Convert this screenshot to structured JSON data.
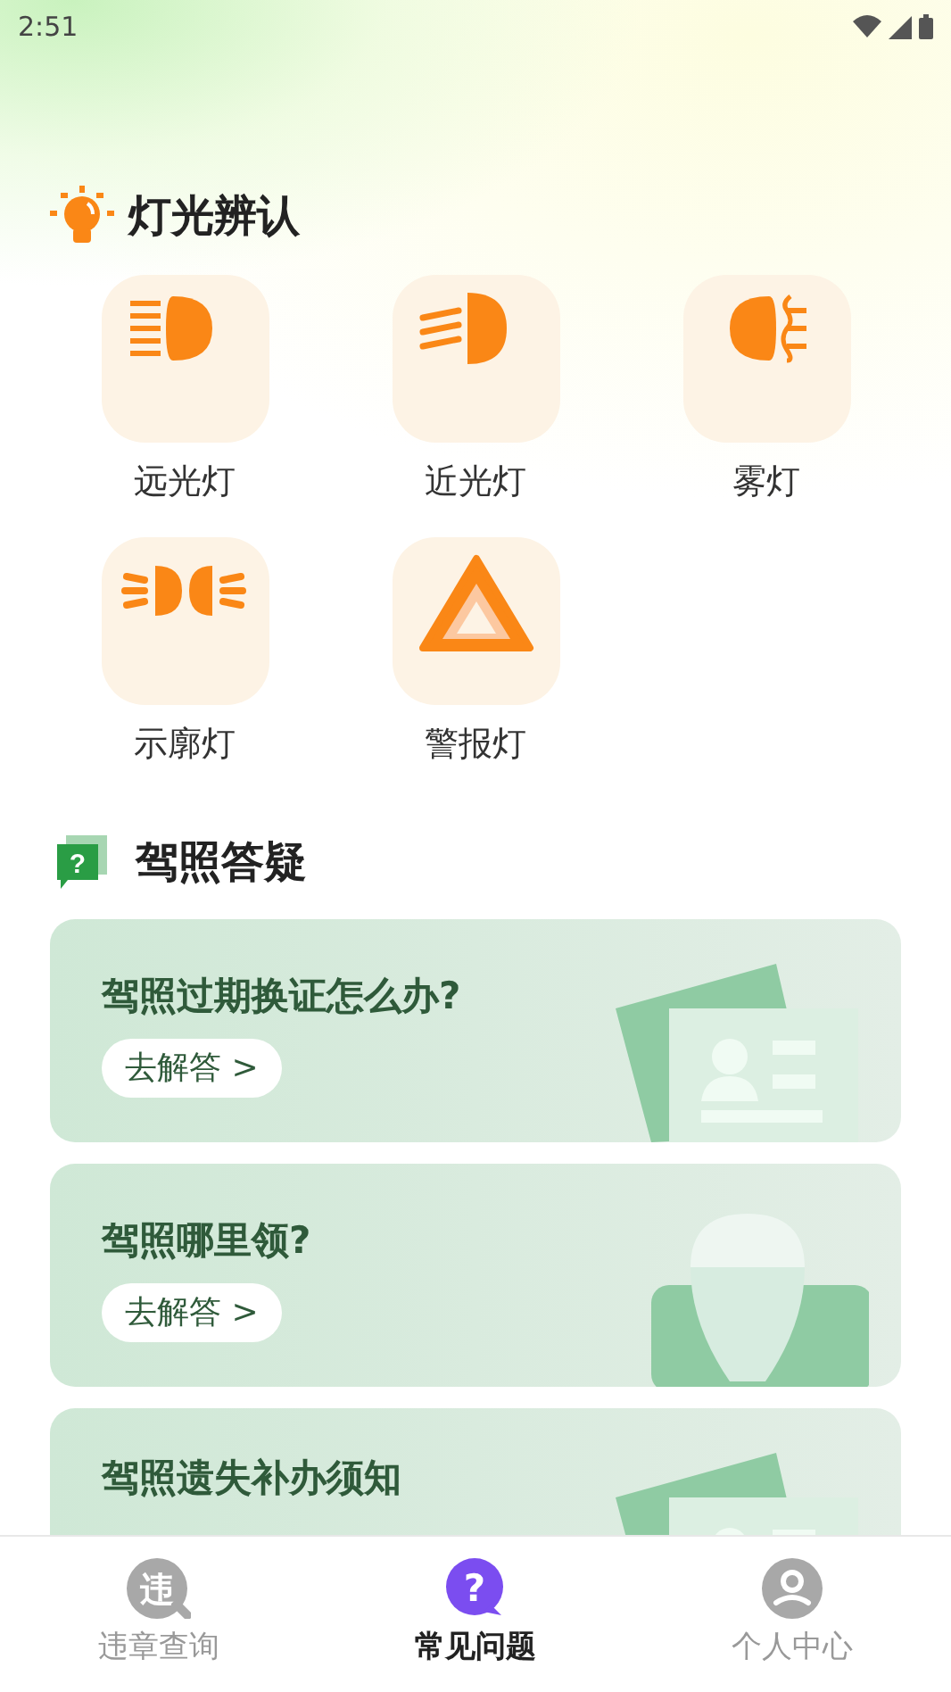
{
  "status_bar": {
    "time": "2:51"
  },
  "lights_section": {
    "title": "灯光辨认",
    "items": [
      {
        "label": "远光灯",
        "kind": "high-beam"
      },
      {
        "label": "近光灯",
        "kind": "low-beam"
      },
      {
        "label": "雾灯",
        "kind": "fog"
      },
      {
        "label": "示廓灯",
        "kind": "marker"
      },
      {
        "label": "警报灯",
        "kind": "hazard"
      }
    ]
  },
  "faq_section": {
    "title": "驾照答疑",
    "icon_text": "?",
    "cards": [
      {
        "title": "驾照过期换证怎么办?",
        "button": "去解答 >",
        "kind": "card"
      },
      {
        "title": "驾照哪里领?",
        "button": "去解答 >",
        "kind": "pin"
      },
      {
        "title": "驾照遗失补办须知",
        "kind": "card"
      }
    ]
  },
  "tab_bar": [
    {
      "label": "违章查询",
      "icon_text": "违",
      "kind": "search",
      "selected": false
    },
    {
      "label": "常见问题",
      "icon_text": "?",
      "kind": "question",
      "selected": true
    },
    {
      "label": "个人中心",
      "kind": "person",
      "selected": false
    }
  ]
}
